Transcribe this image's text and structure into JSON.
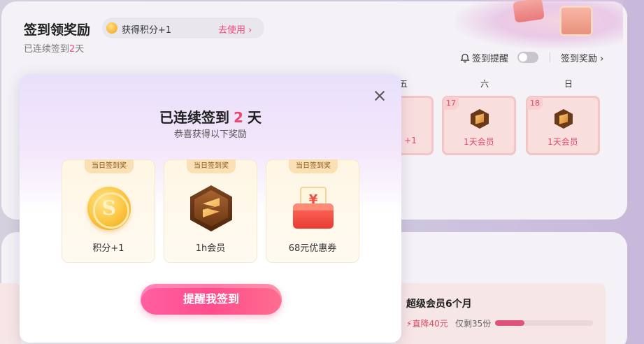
{
  "page": {
    "title": "签到领奖励",
    "points_pill": {
      "text": "获得积分+1",
      "action": "去使用 ›"
    },
    "streak_prefix": "已连续签到",
    "streak_days": "2",
    "streak_suffix": "天",
    "remind_label": "签到提醒",
    "reward_link": "签到奖励 ›",
    "days": [
      {
        "head": "五",
        "num": "",
        "label": "+1"
      },
      {
        "head": "六",
        "num": "17",
        "label": "1天会员"
      },
      {
        "head": "日",
        "num": "18",
        "label": "1天会员"
      }
    ],
    "promo": {
      "title": "超级会员6个月",
      "drop": "直降40元",
      "remaining": "仅剩35份",
      "progress": 0.3
    }
  },
  "modal": {
    "title_prefix": "已连续签到",
    "title_days": "2",
    "title_suffix": "天",
    "subtitle": "恭喜获得以下奖励",
    "rewards": [
      {
        "tag": "当日签到奖",
        "label": "积分+1",
        "icon": "coin-icon"
      },
      {
        "tag": "当日签到奖",
        "label": "1h会员",
        "icon": "vip-badge-icon"
      },
      {
        "tag": "当日签到奖",
        "label": "68元优惠券",
        "icon": "coupon-icon",
        "icon_text": "¥"
      }
    ],
    "cta_label": "提醒我签到",
    "colors": {
      "accent": "#f0456b",
      "cta": "#ff4d8d"
    }
  }
}
